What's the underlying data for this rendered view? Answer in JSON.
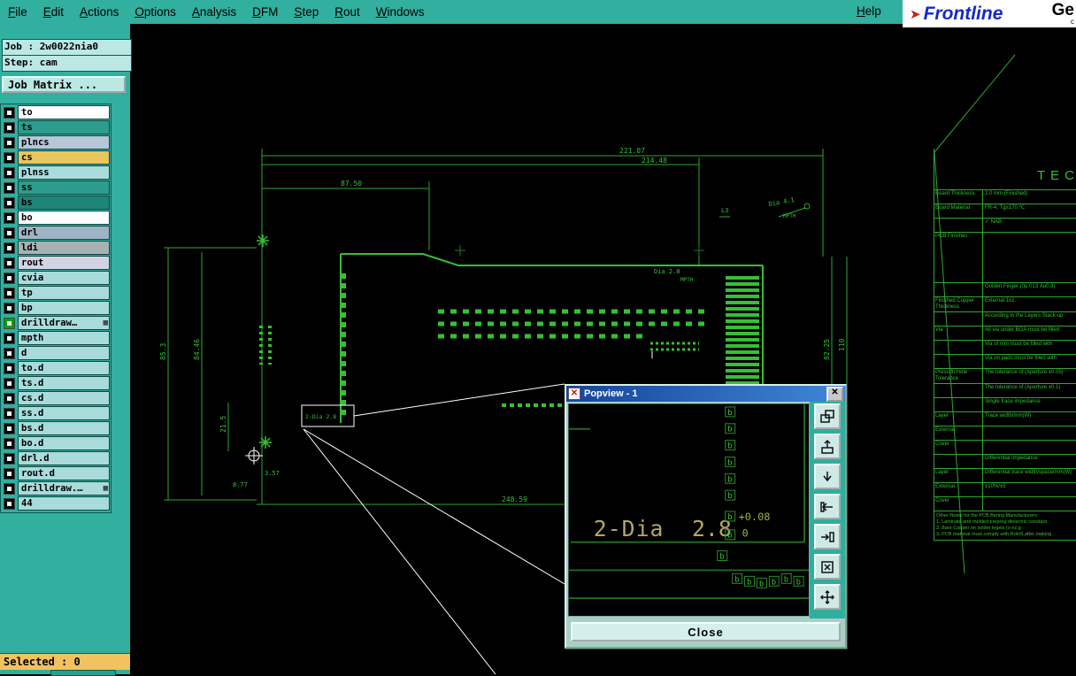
{
  "colors": {
    "accent_teal": "#31AF9F",
    "highlight_yellow": "#F2C25E",
    "draw_green": "#35C035",
    "title_blue": "#16459A",
    "layer_selected": "#00A200"
  },
  "menu_bar": {
    "items": [
      "File",
      "Edit",
      "Actions",
      "Options",
      "Analysis",
      "DFM",
      "Step",
      "Rout",
      "Windows"
    ],
    "help": "Help"
  },
  "logo": {
    "brand": "Frontline",
    "partial": "Ge",
    "sub": "c"
  },
  "job_panel": {
    "job": "Job : 2w0022nia0",
    "step": "Step: cam",
    "matrix_button": "Job Matrix ..."
  },
  "layers": {
    "items": [
      {
        "name": "to",
        "color": "#FFFFFF"
      },
      {
        "name": "ts",
        "color": "#2E9C8C"
      },
      {
        "name": "plncs",
        "color": "#B7C6D8"
      },
      {
        "name": "cs",
        "color": "#EAC45C"
      },
      {
        "name": "plnss",
        "color": "#A9DBDB"
      },
      {
        "name": "ss",
        "color": "#2E9C8C"
      },
      {
        "name": "bs",
        "color": "#1E8578"
      },
      {
        "name": "bo",
        "color": "#FFFFFF"
      },
      {
        "name": "drl",
        "color": "#9FB3C6"
      },
      {
        "name": "ldi",
        "color": "#A9B2B2"
      },
      {
        "name": "rout",
        "color": "#D3D3E6"
      },
      {
        "name": "cvia",
        "color": "#A9DBDB"
      },
      {
        "name": "tp",
        "color": "#A9DBDB"
      },
      {
        "name": "bp",
        "color": "#A9DBDB"
      },
      {
        "name": "drilldraw…",
        "color": "#A9DBDB",
        "selected": true,
        "badge": "▦"
      },
      {
        "name": "mpth",
        "color": "#A9DBDB"
      },
      {
        "name": "d",
        "color": "#A9DBDB"
      },
      {
        "name": "to.d",
        "color": "#A9DBDB"
      },
      {
        "name": "ts.d",
        "color": "#A9DBDB"
      },
      {
        "name": "cs.d",
        "color": "#A9DBDB"
      },
      {
        "name": "ss.d",
        "color": "#A9DBDB"
      },
      {
        "name": "bs.d",
        "color": "#A9DBDB"
      },
      {
        "name": "bo.d",
        "color": "#A9DBDB"
      },
      {
        "name": "drl.d",
        "color": "#A9DBDB"
      },
      {
        "name": "rout.d",
        "color": "#A9DBDB"
      },
      {
        "name": "drilldraw.…",
        "color": "#A9DBDB",
        "badge": "▦"
      },
      {
        "name": "44",
        "color": "#A9DBDB"
      }
    ]
  },
  "status_bar": {
    "selected": "Selected : 0"
  },
  "drawing": {
    "dim_total": "221.07",
    "dim_inner": "214.48",
    "dim_left": "87.50",
    "dim_h1": "85.3",
    "dim_h2": "84.46",
    "dim_small": "21.5",
    "dim_tiny": "8.77",
    "dim_tiny2": "3.57",
    "dim_bottom": "248.59",
    "dim_right": "82.25",
    "dim_right2": "110",
    "note_dia": "Dia 4.1",
    "note_mpth": "MPTH",
    "note_l3": "L3",
    "note_dia2": "Dia 2.8",
    "note_mpth2": "MPTH",
    "zoom_box_label": "2-Dia 2.8"
  },
  "popup": {
    "title": "Popview - 1",
    "dia_label": "2-Dia",
    "dia_value": "2.8",
    "tol_upper": "+0.08",
    "tol_lower": "0",
    "marker": "b",
    "close_button": "Close"
  },
  "spec_table": {
    "title": "TEC",
    "rows": [
      {
        "l": "Board Thickness",
        "v": "2.0 mm (Finished)"
      },
      {
        "l": "Board Material",
        "v": "FR-4, Tg≥170 ℃"
      },
      {
        "l": "",
        "v": "✓ NAB"
      },
      {
        "l": "PCB Finishes",
        "v": "",
        "cls": "tall"
      },
      {
        "l": "",
        "v": "Golden Finger (0μ.013 Au0.8)"
      },
      {
        "l": "Finished Copper Thickness",
        "v": "External    1oz."
      },
      {
        "l": "",
        "v": "According to the Layers Stack-up"
      },
      {
        "l": "Via",
        "v": "All via under BGA must be filled"
      },
      {
        "l": "",
        "v": "Via of      mm must be filled with"
      },
      {
        "l": "",
        "v": "Via on pads must be filled with"
      },
      {
        "l": "Press-fit Hole Tolerance",
        "v": "The tolerance of  (Aperture ±0.05)"
      },
      {
        "l": "",
        "v": "The tolerance of  (Aperture ±0.1)"
      },
      {
        "l": "",
        "v": "Single trace impedance"
      },
      {
        "l": "Layer",
        "v": "Trace width/mm(W)"
      },
      {
        "l": "External",
        "v": ""
      },
      {
        "l": "Cover",
        "v": ""
      },
      {
        "l": "",
        "v": "Differential impedance"
      },
      {
        "l": "Layer",
        "v": "Differential trace width/space/mm(W)"
      },
      {
        "l": "External",
        "v": "±10%/±5"
      },
      {
        "l": "Cover",
        "v": ""
      }
    ],
    "notes": [
      "Other Notes for the PCB Bering Manufacturers:",
      "1. Laminate and molded prepreg dielectric constant",
      "2. Bare Copper on solder legels (o   ez.g",
      "3. PCB material must comply with RoHS,after making"
    ]
  }
}
